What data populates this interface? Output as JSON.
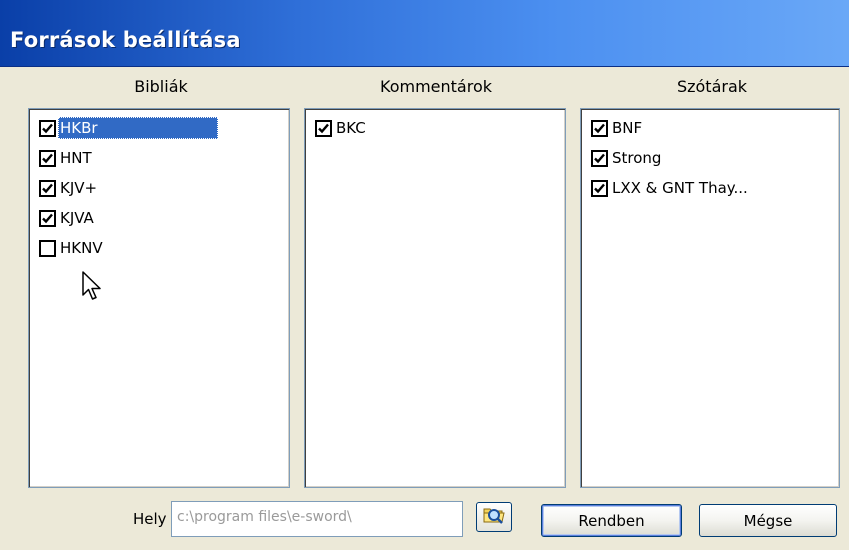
{
  "window": {
    "title": "Források beállítása"
  },
  "columns": [
    {
      "header": "Bibliák",
      "items": [
        {
          "label": "HKBr",
          "checked": true,
          "selected": true
        },
        {
          "label": "HNT",
          "checked": true
        },
        {
          "label": "KJV+",
          "checked": true
        },
        {
          "label": "KJVA",
          "checked": true
        },
        {
          "label": "HKNV",
          "checked": false
        }
      ]
    },
    {
      "header": "Kommentárok",
      "items": [
        {
          "label": "BKC",
          "checked": true
        }
      ]
    },
    {
      "header": "Szótárak",
      "items": [
        {
          "label": "BNF",
          "checked": true
        },
        {
          "label": "Strong",
          "checked": true
        },
        {
          "label": "LXX & GNT Thay...",
          "checked": true
        }
      ]
    }
  ],
  "footer": {
    "location_label": "Hely",
    "location_value": "c:\\program files\\e-sword\\",
    "ok_label": "Rendben",
    "cancel_label": "Mégse"
  },
  "icons": {
    "browse": "folder-search-icon",
    "cursor": "mouse-pointer-icon"
  },
  "colors": {
    "titlebar": "#2f6fd8",
    "selection": "#316ac5",
    "dialog_bg": "#ece9d8"
  }
}
